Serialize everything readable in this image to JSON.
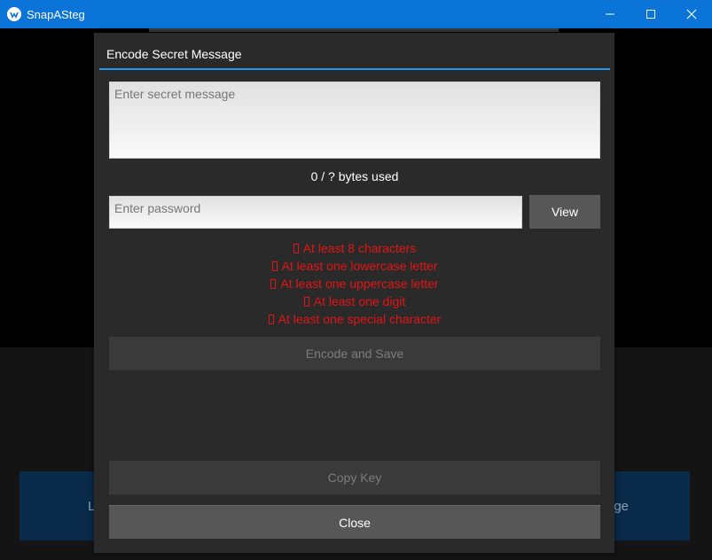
{
  "window": {
    "title": "SnapASteg",
    "accent": "#0a74d9"
  },
  "background": {
    "left_button_label": "L",
    "right_button_label": "age"
  },
  "dialog": {
    "title": "Encode Secret Message",
    "accent_line_color": "#2196f3",
    "message": {
      "value": "",
      "placeholder": "Enter secret message"
    },
    "bytes_used": "0 / ? bytes used",
    "password": {
      "value": "",
      "placeholder": "Enter password"
    },
    "view_label": "View",
    "rules": [
      "At least 8 characters",
      "At least one lowercase letter",
      "At least one uppercase letter",
      "At least one digit",
      "At least one special character"
    ],
    "rule_color": "#e31414",
    "encode_label": "Encode and Save",
    "copy_key_label": "Copy Key",
    "close_label": "Close"
  }
}
